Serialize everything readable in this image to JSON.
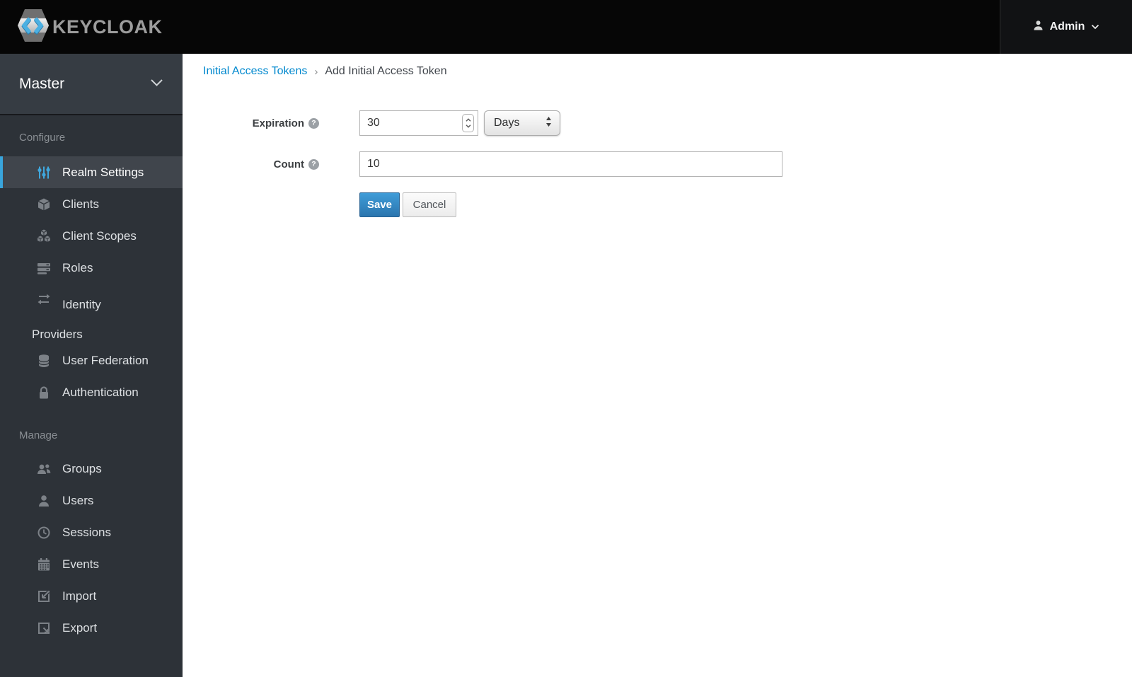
{
  "topbar": {
    "brand": "KEYCLOAK",
    "user": {
      "name": "Admin",
      "icon": "user-icon",
      "caret": "chevron-down-icon"
    }
  },
  "sidebar": {
    "realm": "Master",
    "realm_caret": "chevron-down-icon",
    "sections": [
      {
        "label": "Configure",
        "items": [
          {
            "label": "Realm Settings",
            "icon": "sliders-icon",
            "active": true
          },
          {
            "label": "Clients",
            "icon": "cube-icon",
            "active": false
          },
          {
            "label": "Client Scopes",
            "icon": "cubes-icon",
            "active": false
          },
          {
            "label": "Roles",
            "icon": "server-icon",
            "active": false
          },
          {
            "label": "Identity Providers",
            "icon": "exchange-arrows-icon",
            "active": false
          },
          {
            "label": "User Federation",
            "icon": "database-icon",
            "active": false
          },
          {
            "label": "Authentication",
            "icon": "lock-icon",
            "active": false
          }
        ]
      },
      {
        "label": "Manage",
        "items": [
          {
            "label": "Groups",
            "icon": "people-icon",
            "active": false
          },
          {
            "label": "Users",
            "icon": "person-icon",
            "active": false
          },
          {
            "label": "Sessions",
            "icon": "clock-icon",
            "active": false
          },
          {
            "label": "Events",
            "icon": "calendar-icon",
            "active": false
          },
          {
            "label": "Import",
            "icon": "import-icon",
            "active": false
          },
          {
            "label": "Export",
            "icon": "export-icon",
            "active": false
          }
        ]
      }
    ]
  },
  "breadcrumb": {
    "link": "Initial Access Tokens",
    "separator": "›",
    "current": "Add Initial Access Token"
  },
  "form": {
    "expiration": {
      "label": "Expiration",
      "value": "30",
      "unit": "Days",
      "help_icon": "help-icon"
    },
    "count": {
      "label": "Count",
      "value": "10",
      "help_icon": "help-icon"
    },
    "save_label": "Save",
    "cancel_label": "Cancel"
  },
  "colors": {
    "topbar_bg": "#060606",
    "sidebar_bg": "#2d3238",
    "active_item_bg": "#40454c",
    "active_border": "#39a5dc",
    "link_blue": "#0088ce",
    "primary_button": "#2b75ae"
  }
}
